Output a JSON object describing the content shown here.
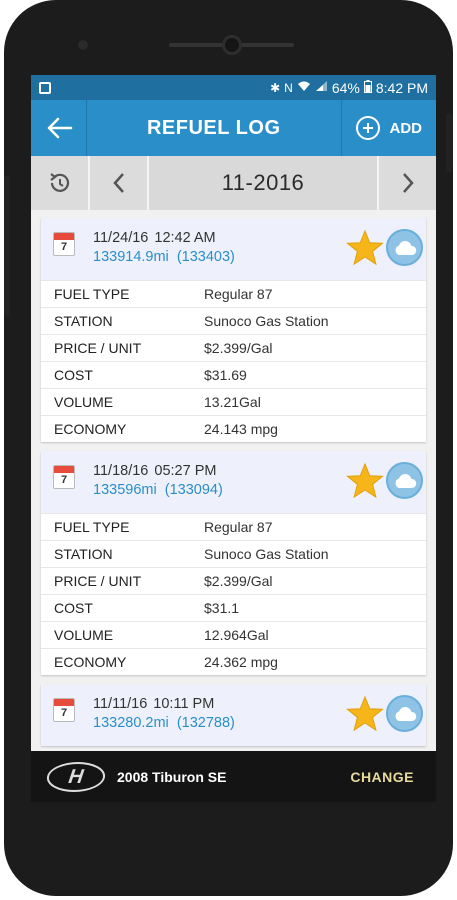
{
  "status_bar": {
    "icons": [
      "bluetooth-icon",
      "nfc-icon",
      "wifi-icon",
      "signal-icon",
      "battery-icon"
    ],
    "battery": "64%",
    "time": "8:42 PM"
  },
  "app_bar": {
    "title": "REFUEL LOG",
    "add_label": "ADD",
    "accent_color": "#2a8ec9"
  },
  "month_nav": {
    "month": "11-2016"
  },
  "fields": [
    "FUEL TYPE",
    "STATION",
    "PRICE / UNIT",
    "COST",
    "VOLUME",
    "ECONOMY"
  ],
  "entries": [
    {
      "calendar_day": "7",
      "date": "11/24/16",
      "time": "12:42 AM",
      "odometer": "133914.9mi",
      "trip": "(133403)",
      "values": [
        "Regular 87",
        "Sunoco Gas Station",
        "$2.399/Gal",
        "$31.69",
        "13.21Gal",
        "24.143 mpg"
      ]
    },
    {
      "calendar_day": "7",
      "date": "11/18/16",
      "time": "05:27 PM",
      "odometer": "133596mi",
      "trip": "(133094)",
      "values": [
        "Regular 87",
        "Sunoco Gas Station",
        "$2.399/Gal",
        "$31.1",
        "12.964Gal",
        "24.362 mpg"
      ]
    },
    {
      "calendar_day": "7",
      "date": "11/11/16",
      "time": "10:11 PM",
      "odometer": "133280.2mi",
      "trip": "(132788)",
      "values": []
    }
  ],
  "bottom_bar": {
    "vehicle": "2008 Tiburon SE",
    "change_label": "CHANGE"
  }
}
